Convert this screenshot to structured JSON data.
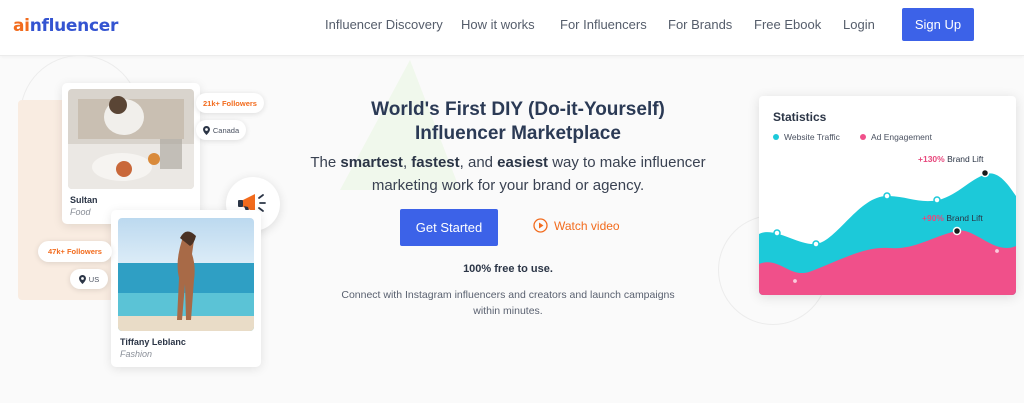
{
  "brand": {
    "logo_a": "ai",
    "logo_rest": "nfluencer",
    "orange": "#f26b1d",
    "blue": "#3454d1"
  },
  "nav": {
    "items": [
      "Influencer Discovery",
      "How it works",
      "For Influencers",
      "For Brands",
      "Free Ebook",
      "Login"
    ],
    "signup_label": "Sign Up"
  },
  "hero": {
    "title_line1": "World's First DIY (Do-it-Yourself)",
    "title_line2": "Influencer Marketplace",
    "sub_pre": "The ",
    "sub_b1": "smartest",
    "sub_sep1": ", ",
    "sub_b2": "fastest",
    "sub_sep2": ", and ",
    "sub_b3": "easiest",
    "sub_post": " way to make influencer marketing work for your brand or agency.",
    "cta_label": "Get Started",
    "watch_label": "Watch video",
    "free_label": "100% free to use.",
    "connect_text": "Connect with Instagram influencers and creators and launch campaigns within minutes."
  },
  "cards": [
    {
      "name": "Sultan",
      "category": "Food",
      "followers": "21k+ Followers",
      "country": "Canada"
    },
    {
      "name": "Tiffany Leblanc",
      "category": "Fashion",
      "followers": "47k+ Followers",
      "country": "US"
    }
  ],
  "stats": {
    "title": "Statistics",
    "legend": [
      {
        "label": "Website Traffic",
        "color": "#1cc9d9"
      },
      {
        "label": "Ad Engagement",
        "color": "#f0508a"
      }
    ],
    "lifts": [
      {
        "pct": "+130%",
        "label": " Brand Lift"
      },
      {
        "pct": "+90%",
        "label": " Brand Lift"
      }
    ]
  },
  "icons": [
    "megaphone-icon",
    "location-pin-icon",
    "play-circle-icon"
  ]
}
